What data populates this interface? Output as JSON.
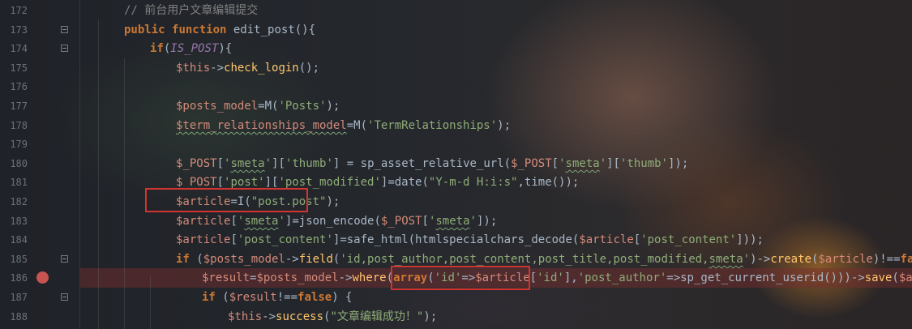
{
  "editor": {
    "lines": [
      {
        "number": "172",
        "fold": false,
        "breakpoint": false,
        "indent": 1,
        "tokens": [
          {
            "t": "// 前台用户文章编辑提交",
            "c": "cm"
          }
        ]
      },
      {
        "number": "173",
        "fold": true,
        "breakpoint": false,
        "indent": 1,
        "tokens": [
          {
            "t": "public",
            "c": "kw"
          },
          {
            "t": " "
          },
          {
            "t": "function",
            "c": "kw"
          },
          {
            "t": " edit_post(){"
          }
        ]
      },
      {
        "number": "174",
        "fold": true,
        "breakpoint": false,
        "indent": 2,
        "tokens": [
          {
            "t": "if",
            "c": "kw"
          },
          {
            "t": "("
          },
          {
            "t": "IS_POST",
            "c": "const"
          },
          {
            "t": "){"
          }
        ]
      },
      {
        "number": "175",
        "fold": false,
        "breakpoint": false,
        "indent": 3,
        "tokens": [
          {
            "t": "$this",
            "c": "var"
          },
          {
            "t": "->"
          },
          {
            "t": "check_login",
            "c": "fn"
          },
          {
            "t": "();"
          }
        ]
      },
      {
        "number": "176",
        "fold": false,
        "breakpoint": false,
        "indent": 0,
        "tokens": []
      },
      {
        "number": "177",
        "fold": false,
        "breakpoint": false,
        "indent": 3,
        "tokens": [
          {
            "t": "$posts_model",
            "c": "var"
          },
          {
            "t": "=M("
          },
          {
            "t": "'Posts'",
            "c": "str"
          },
          {
            "t": ");"
          }
        ]
      },
      {
        "number": "178",
        "fold": false,
        "breakpoint": false,
        "indent": 3,
        "tokens": [
          {
            "t": "$term_relationships_model",
            "c": "var squig"
          },
          {
            "t": "=M("
          },
          {
            "t": "'TermRelationships'",
            "c": "str"
          },
          {
            "t": ");"
          }
        ]
      },
      {
        "number": "179",
        "fold": false,
        "breakpoint": false,
        "indent": 0,
        "tokens": []
      },
      {
        "number": "180",
        "fold": false,
        "breakpoint": false,
        "indent": 3,
        "tokens": [
          {
            "t": "$_POST",
            "c": "var"
          },
          {
            "t": "["
          },
          {
            "t": "'",
            "c": "str"
          },
          {
            "t": "smeta",
            "c": "str squig"
          },
          {
            "t": "'",
            "c": "str"
          },
          {
            "t": "]["
          },
          {
            "t": "'thumb'",
            "c": "str"
          },
          {
            "t": "] = sp_asset_relative_url("
          },
          {
            "t": "$_POST",
            "c": "var"
          },
          {
            "t": "["
          },
          {
            "t": "'",
            "c": "str"
          },
          {
            "t": "smeta",
            "c": "str squig"
          },
          {
            "t": "'",
            "c": "str"
          },
          {
            "t": "]["
          },
          {
            "t": "'thumb'",
            "c": "str"
          },
          {
            "t": "]);"
          }
        ]
      },
      {
        "number": "181",
        "fold": false,
        "breakpoint": false,
        "indent": 3,
        "tokens": [
          {
            "t": "$_POST",
            "c": "var"
          },
          {
            "t": "["
          },
          {
            "t": "'post'",
            "c": "str"
          },
          {
            "t": "]["
          },
          {
            "t": "'post_modified'",
            "c": "str"
          },
          {
            "t": "]=date("
          },
          {
            "t": "\"Y-m-d H:i:s\"",
            "c": "str"
          },
          {
            "t": ",time());"
          }
        ]
      },
      {
        "number": "182",
        "fold": false,
        "breakpoint": false,
        "indent": 3,
        "tokens": [
          {
            "t": "$article",
            "c": "var"
          },
          {
            "t": "=I("
          },
          {
            "t": "\"post.post\"",
            "c": "str"
          },
          {
            "t": ");"
          }
        ]
      },
      {
        "number": "183",
        "fold": false,
        "breakpoint": false,
        "indent": 3,
        "tokens": [
          {
            "t": "$article",
            "c": "var"
          },
          {
            "t": "["
          },
          {
            "t": "'",
            "c": "str"
          },
          {
            "t": "smeta",
            "c": "str squig"
          },
          {
            "t": "'",
            "c": "str"
          },
          {
            "t": "]=json_encode("
          },
          {
            "t": "$_POST",
            "c": "var"
          },
          {
            "t": "["
          },
          {
            "t": "'",
            "c": "str"
          },
          {
            "t": "smeta",
            "c": "str squig"
          },
          {
            "t": "'",
            "c": "str"
          },
          {
            "t": "]);"
          }
        ]
      },
      {
        "number": "184",
        "fold": false,
        "breakpoint": false,
        "indent": 3,
        "tokens": [
          {
            "t": "$article",
            "c": "var"
          },
          {
            "t": "["
          },
          {
            "t": "'post_content'",
            "c": "str"
          },
          {
            "t": "]=safe_html(htmlspecialchars_decode("
          },
          {
            "t": "$article",
            "c": "var"
          },
          {
            "t": "["
          },
          {
            "t": "'post_content'",
            "c": "str"
          },
          {
            "t": "]));"
          }
        ]
      },
      {
        "number": "185",
        "fold": true,
        "breakpoint": false,
        "indent": 3,
        "tokens": [
          {
            "t": "if",
            "c": "kw"
          },
          {
            "t": " ("
          },
          {
            "t": "$posts_model",
            "c": "var"
          },
          {
            "t": "->"
          },
          {
            "t": "field",
            "c": "fn"
          },
          {
            "t": "("
          },
          {
            "t": "'id,post_author,post_content,post_title,post_modified,",
            "c": "str"
          },
          {
            "t": "smeta",
            "c": "str squig"
          },
          {
            "t": "'",
            "c": "str"
          },
          {
            "t": ")->"
          },
          {
            "t": "create",
            "c": "fn"
          },
          {
            "t": "("
          },
          {
            "t": "$article",
            "c": "var"
          },
          {
            "t": ")!=="
          },
          {
            "t": "false",
            "c": "kw"
          },
          {
            "t": ") {"
          }
        ]
      },
      {
        "number": "186",
        "fold": false,
        "breakpoint": true,
        "indent": 4,
        "tokens": [
          {
            "t": "$result",
            "c": "var"
          },
          {
            "t": "="
          },
          {
            "t": "$posts_model",
            "c": "var"
          },
          {
            "t": "->"
          },
          {
            "t": "where",
            "c": "fn"
          },
          {
            "t": "("
          },
          {
            "t": "array",
            "c": "kw"
          },
          {
            "t": "("
          },
          {
            "t": "'id'",
            "c": "str"
          },
          {
            "t": "=>"
          },
          {
            "t": "$article",
            "c": "var"
          },
          {
            "t": "["
          },
          {
            "t": "'id'",
            "c": "str"
          },
          {
            "t": "],"
          },
          {
            "t": "'post_author'",
            "c": "str"
          },
          {
            "t": "=>sp_get_current_userid()))->"
          },
          {
            "t": "save",
            "c": "fn"
          },
          {
            "t": "("
          },
          {
            "t": "$article",
            "c": "var"
          },
          {
            "t": ");"
          }
        ]
      },
      {
        "number": "187",
        "fold": true,
        "breakpoint": false,
        "indent": 4,
        "tokens": [
          {
            "t": "if",
            "c": "kw"
          },
          {
            "t": " ("
          },
          {
            "t": "$result",
            "c": "var"
          },
          {
            "t": "!=="
          },
          {
            "t": "false",
            "c": "kw"
          },
          {
            "t": ") {"
          }
        ]
      },
      {
        "number": "188",
        "fold": false,
        "breakpoint": false,
        "indent": 5,
        "tokens": [
          {
            "t": "$this",
            "c": "var"
          },
          {
            "t": "->"
          },
          {
            "t": "success",
            "c": "fn"
          },
          {
            "t": "("
          },
          {
            "t": "\"文章编辑成功！\"",
            "c": "str"
          },
          {
            "t": ");"
          }
        ]
      }
    ]
  },
  "colors": {
    "keyword": "#cc7832",
    "variable": "#d48a7a",
    "string": "#8fad78",
    "comment": "#808080",
    "function": "#ffc66d",
    "constant": "#9876aa",
    "breakpoint": "#c75450",
    "highlight_box": "#d2342f"
  }
}
